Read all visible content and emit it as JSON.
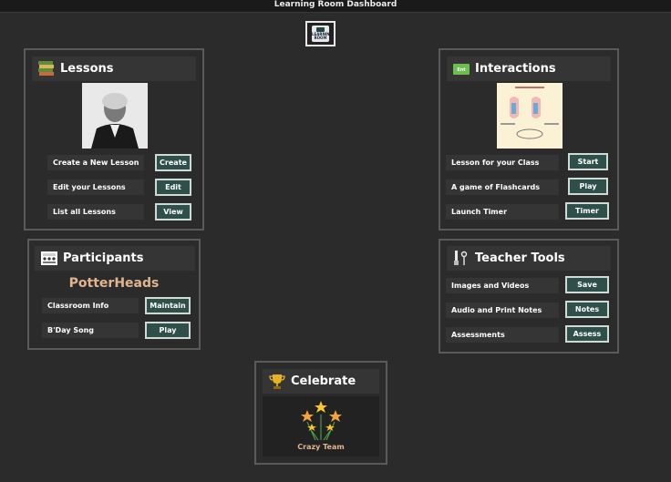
{
  "window": {
    "title": "Learning Room Dashboard"
  },
  "logo": {
    "text": "LEARNING ROOM"
  },
  "lessons": {
    "title": "Lessons",
    "icon": "books-icon",
    "image": "portrait-photo",
    "rows": [
      {
        "label": "Create a New Lesson",
        "button": "Create"
      },
      {
        "label": "Edit your Lessons",
        "button": "Edit"
      },
      {
        "label": "List all Lessons",
        "button": "View"
      }
    ]
  },
  "interactions": {
    "title": "Interactions",
    "icon": "interact-icon",
    "image": "diagram-thumbnail",
    "rows": [
      {
        "label": "Lesson for your Class",
        "button": "Start"
      },
      {
        "label": "A game of Flashcards",
        "button": "Play"
      },
      {
        "label": "Launch Timer",
        "button": "Timer"
      }
    ]
  },
  "participants": {
    "title": "Participants",
    "icon": "classroom-icon",
    "group_name": "PotterHeads",
    "rows": [
      {
        "label": "Classroom Info",
        "button": "Maintain"
      },
      {
        "label": "B'Day Song",
        "button": "Play"
      }
    ]
  },
  "teacher_tools": {
    "title": "Teacher Tools",
    "icon": "tools-icon",
    "rows": [
      {
        "label": "Images and Videos",
        "button": "Save"
      },
      {
        "label": "Audio and Print Notes",
        "button": "Notes"
      },
      {
        "label": "Assessments",
        "button": "Assess"
      }
    ]
  },
  "celebrate": {
    "title": "Celebrate",
    "icon": "trophy-icon",
    "team": "Crazy Team"
  },
  "colors": {
    "background": "#2b2b2b",
    "panel_border": "#5a5a5a",
    "header": "#353535",
    "button": "#2f4f4a",
    "accent_text": "#e0b48e"
  }
}
